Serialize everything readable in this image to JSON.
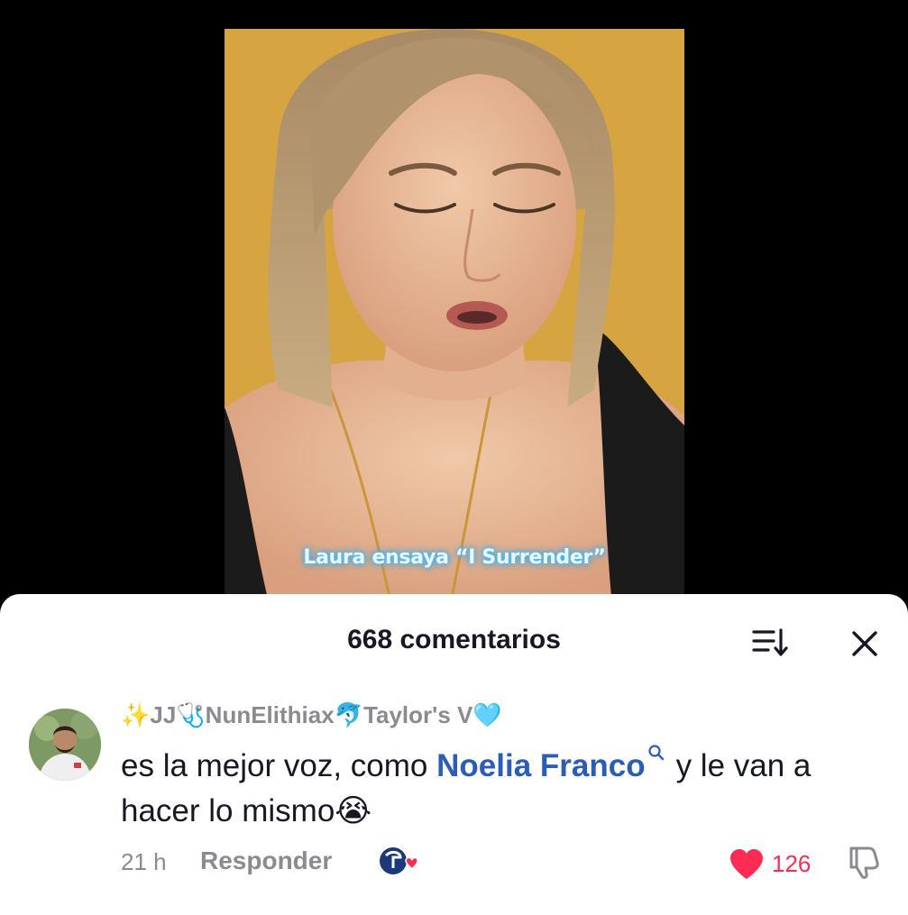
{
  "video": {
    "caption": "Laura ensaya “I Surrender”"
  },
  "comments_sheet": {
    "title": "668 comentarios",
    "sort_icon": "sort-descending-icon",
    "close_icon": "close-icon"
  },
  "comment": {
    "username_emoji_1": "✨",
    "username_part_1": "JJ",
    "username_emoji_2": "🩺",
    "username_part_2": "NunElithiax",
    "username_emoji_3": "🐬",
    "username_part_3": "Taylor's V",
    "username_emoji_4": "🩵",
    "text_before_mention": "es la mejor voz, como ",
    "mention": "Noelia Franco",
    "text_after_mention": "y le van a hacer lo mismo",
    "text_emoji": "😭",
    "time": "21 h",
    "reply_label": "Responder",
    "like_count": "126",
    "liked": true,
    "colors": {
      "like": "#fe2c55",
      "mention": "#2b5db5",
      "secondary_text": "#8a8b91"
    }
  }
}
